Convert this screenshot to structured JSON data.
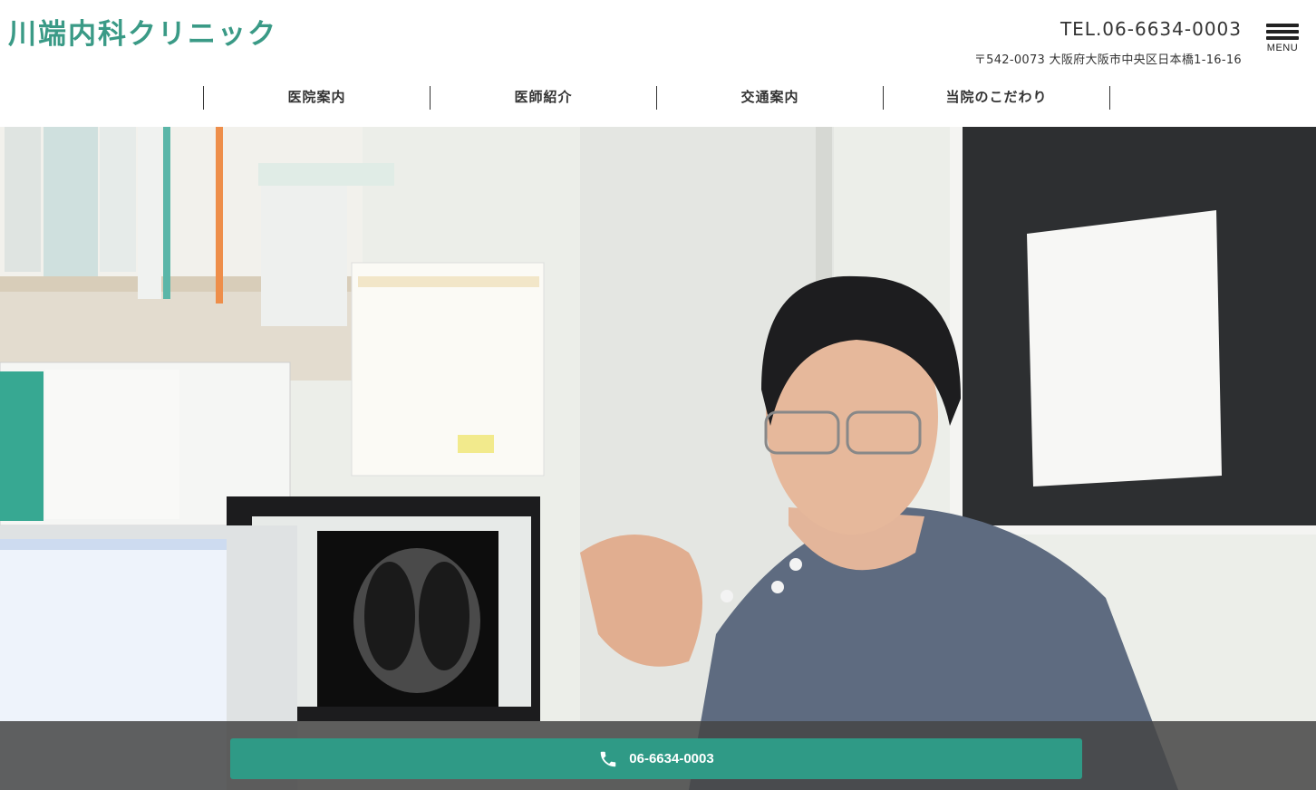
{
  "header": {
    "clinic_name": "川端内科クリニック",
    "tel": "TEL.06-6634-0003",
    "address": "〒542-0073 大阪府大阪市中央区日本橋1-16-16",
    "menu_label": "MENU"
  },
  "nav": {
    "items": [
      {
        "label": "医院案内"
      },
      {
        "label": "医師紹介"
      },
      {
        "label": "交通案内"
      },
      {
        "label": "当院のこだわり"
      }
    ]
  },
  "hero": {
    "image_description_icon": "doctor-photo"
  },
  "callbar": {
    "phone_number": "06-6634-0003",
    "icon": "phone-icon"
  },
  "colors": {
    "brand": "#3a9a86",
    "call_button": "#2f9a86",
    "callbar_bg": "#464646"
  }
}
